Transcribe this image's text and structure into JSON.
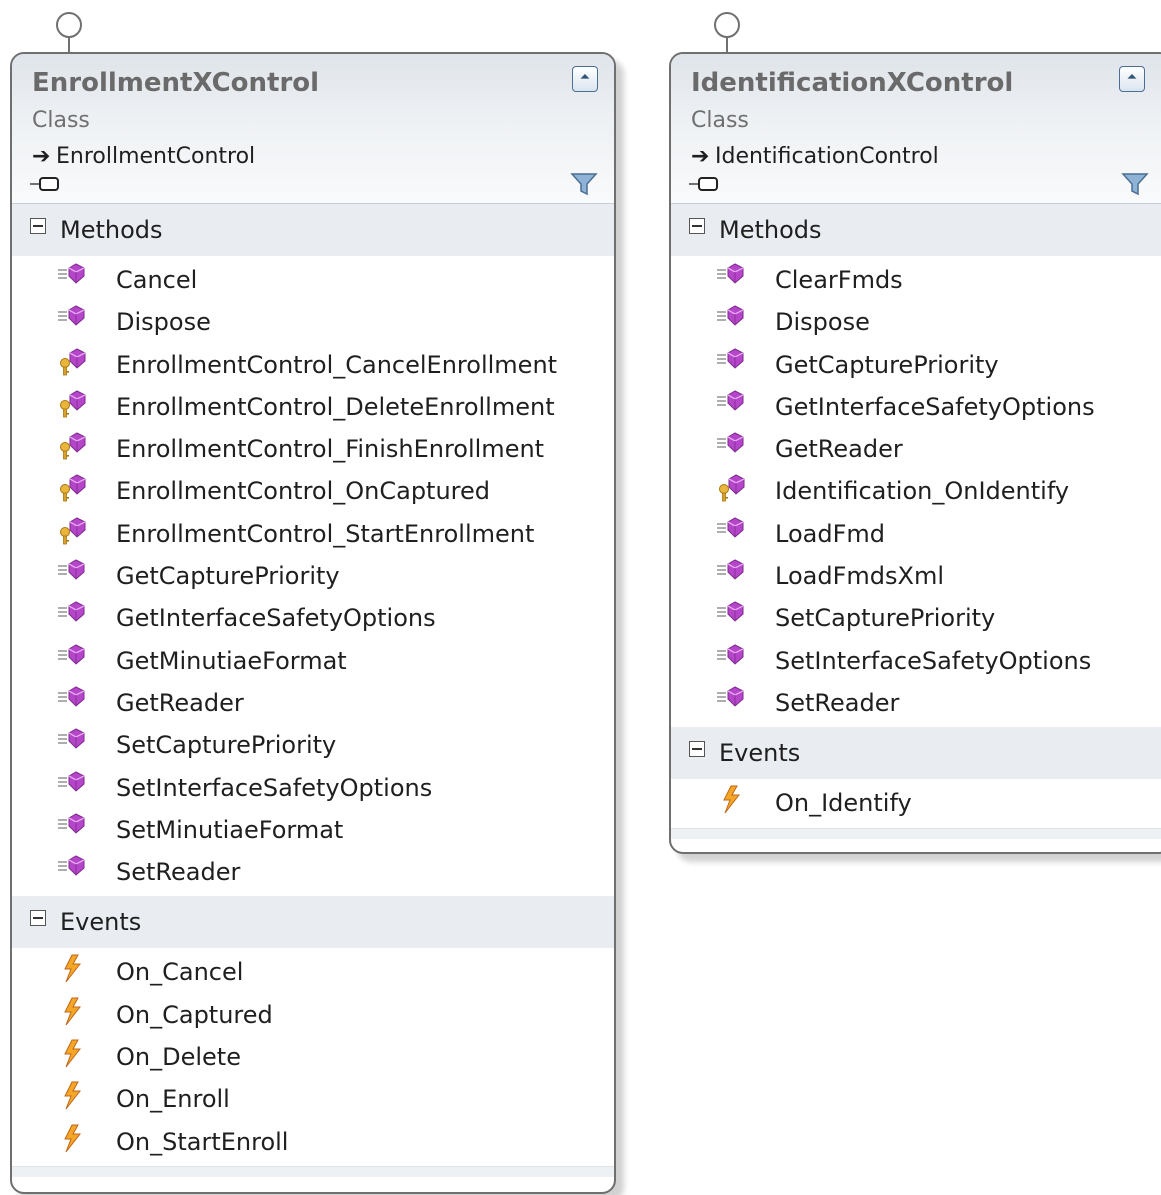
{
  "classes": [
    {
      "name": "EnrollmentXControl",
      "kind": "Class",
      "base": "EnrollmentControl",
      "sections": [
        {
          "label": "Methods",
          "items": [
            {
              "name": "Cancel",
              "icon": "public-method-icon"
            },
            {
              "name": "Dispose",
              "icon": "public-method-icon"
            },
            {
              "name": "EnrollmentControl_CancelEnrollment",
              "icon": "private-method-icon"
            },
            {
              "name": "EnrollmentControl_DeleteEnrollment",
              "icon": "private-method-icon"
            },
            {
              "name": "EnrollmentControl_FinishEnrollment",
              "icon": "private-method-icon"
            },
            {
              "name": "EnrollmentControl_OnCaptured",
              "icon": "private-method-icon"
            },
            {
              "name": "EnrollmentControl_StartEnrollment",
              "icon": "private-method-icon"
            },
            {
              "name": "GetCapturePriority",
              "icon": "public-method-icon"
            },
            {
              "name": "GetInterfaceSafetyOptions",
              "icon": "public-method-icon"
            },
            {
              "name": "GetMinutiaeFormat",
              "icon": "public-method-icon"
            },
            {
              "name": "GetReader",
              "icon": "public-method-icon"
            },
            {
              "name": "SetCapturePriority",
              "icon": "public-method-icon"
            },
            {
              "name": "SetInterfaceSafetyOptions",
              "icon": "public-method-icon"
            },
            {
              "name": "SetMinutiaeFormat",
              "icon": "public-method-icon"
            },
            {
              "name": "SetReader",
              "icon": "public-method-icon"
            }
          ]
        },
        {
          "label": "Events",
          "items": [
            {
              "name": "On_Cancel",
              "icon": "event-icon"
            },
            {
              "name": "On_Captured",
              "icon": "event-icon"
            },
            {
              "name": "On_Delete",
              "icon": "event-icon"
            },
            {
              "name": "On_Enroll",
              "icon": "event-icon"
            },
            {
              "name": "On_StartEnroll",
              "icon": "event-icon"
            }
          ]
        }
      ]
    },
    {
      "name": "IdentificationXControl",
      "kind": "Class",
      "base": "IdentificationControl",
      "sections": [
        {
          "label": "Methods",
          "items": [
            {
              "name": "ClearFmds",
              "icon": "public-method-icon"
            },
            {
              "name": "Dispose",
              "icon": "public-method-icon"
            },
            {
              "name": "GetCapturePriority",
              "icon": "public-method-icon"
            },
            {
              "name": "GetInterfaceSafetyOptions",
              "icon": "public-method-icon"
            },
            {
              "name": "GetReader",
              "icon": "public-method-icon"
            },
            {
              "name": "Identification_OnIdentify",
              "icon": "private-method-icon"
            },
            {
              "name": "LoadFmd",
              "icon": "public-method-icon"
            },
            {
              "name": "LoadFmdsXml",
              "icon": "public-method-icon"
            },
            {
              "name": "SetCapturePriority",
              "icon": "public-method-icon"
            },
            {
              "name": "SetInterfaceSafetyOptions",
              "icon": "public-method-icon"
            },
            {
              "name": "SetReader",
              "icon": "public-method-icon"
            }
          ]
        },
        {
          "label": "Events",
          "items": [
            {
              "name": "On_Identify",
              "icon": "event-icon"
            }
          ]
        }
      ]
    }
  ],
  "colors": {
    "method": "#b545c9",
    "event": "#f0a020",
    "border": "#6f6f6f"
  }
}
